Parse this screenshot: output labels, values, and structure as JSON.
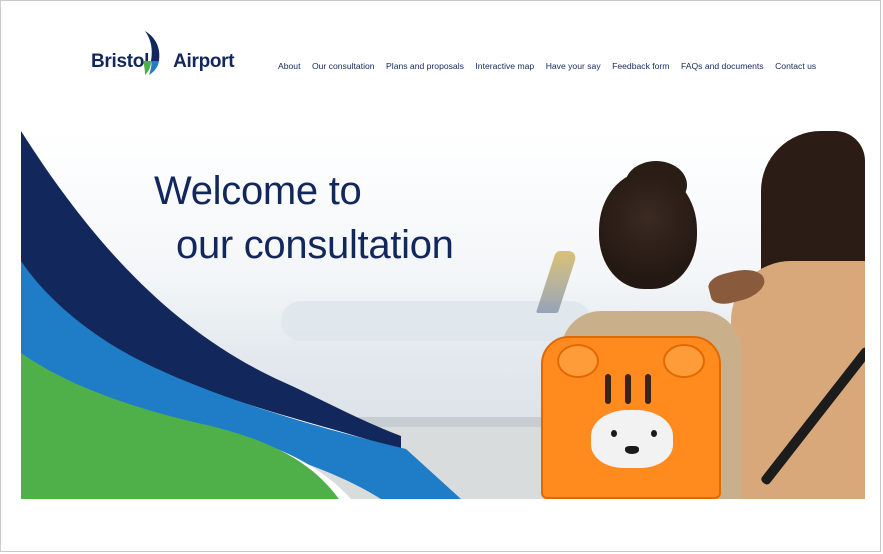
{
  "brand": {
    "logo_text_left": "Bristol",
    "logo_text_right": "Airport",
    "colors": {
      "navy": "#12285c",
      "blue": "#1f7cc7",
      "green": "#4fb04a",
      "orange": "#ff8a1e"
    }
  },
  "nav": {
    "items": [
      {
        "label": "About"
      },
      {
        "label": "Our consultation"
      },
      {
        "label": "Plans and proposals"
      },
      {
        "label": "Interactive map"
      },
      {
        "label": "Have your say"
      },
      {
        "label": "Feedback form"
      },
      {
        "label": "FAQs and documents"
      },
      {
        "label": "Contact us"
      }
    ]
  },
  "hero": {
    "title_line1": "Welcome to",
    "title_line2": "our consultation",
    "image_icon": "family-at-airport-window-photo"
  }
}
